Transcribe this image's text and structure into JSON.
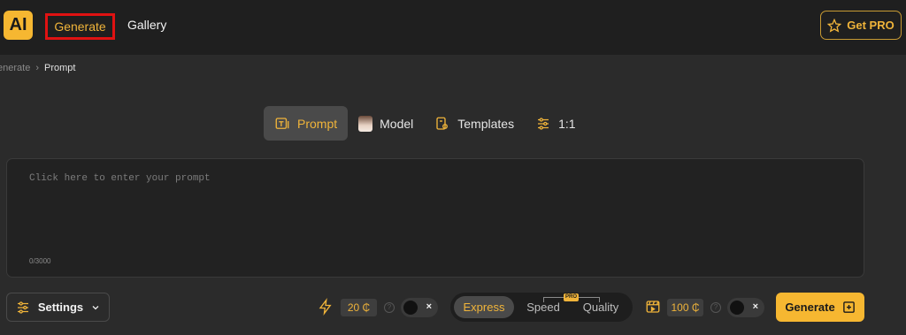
{
  "header": {
    "logo_text": "AI",
    "nav": {
      "generate": "Generate",
      "gallery": "Gallery"
    },
    "get_pro": "Get PRO"
  },
  "breadcrumb": {
    "parent": "Generate",
    "parent_visible": "enerate",
    "current": "Prompt"
  },
  "tabs": [
    {
      "label": "Prompt",
      "icon": "text-box-icon",
      "active": true
    },
    {
      "label": "Model",
      "icon": "model-avatar"
    },
    {
      "label": "Templates",
      "icon": "templates-icon"
    },
    {
      "label": "1:1",
      "icon": "sliders-icon"
    }
  ],
  "prompt": {
    "placeholder": "Click here to enter your prompt",
    "count": "0/3000"
  },
  "bottom_bar": {
    "settings_label": "Settings",
    "speed_credits": "20 ₵",
    "modes": [
      {
        "label": "Express",
        "active": true
      },
      {
        "label": "Speed"
      },
      {
        "label": "Quality"
      }
    ],
    "pro_tag": "PRO",
    "video_credits": "100 ₵",
    "toggle_x": "×",
    "generate_label": "Generate"
  },
  "colors": {
    "accent": "#f6b731",
    "background": "#2b2b2b",
    "header": "#1f1f1f",
    "highlight_box": "#e01212"
  }
}
